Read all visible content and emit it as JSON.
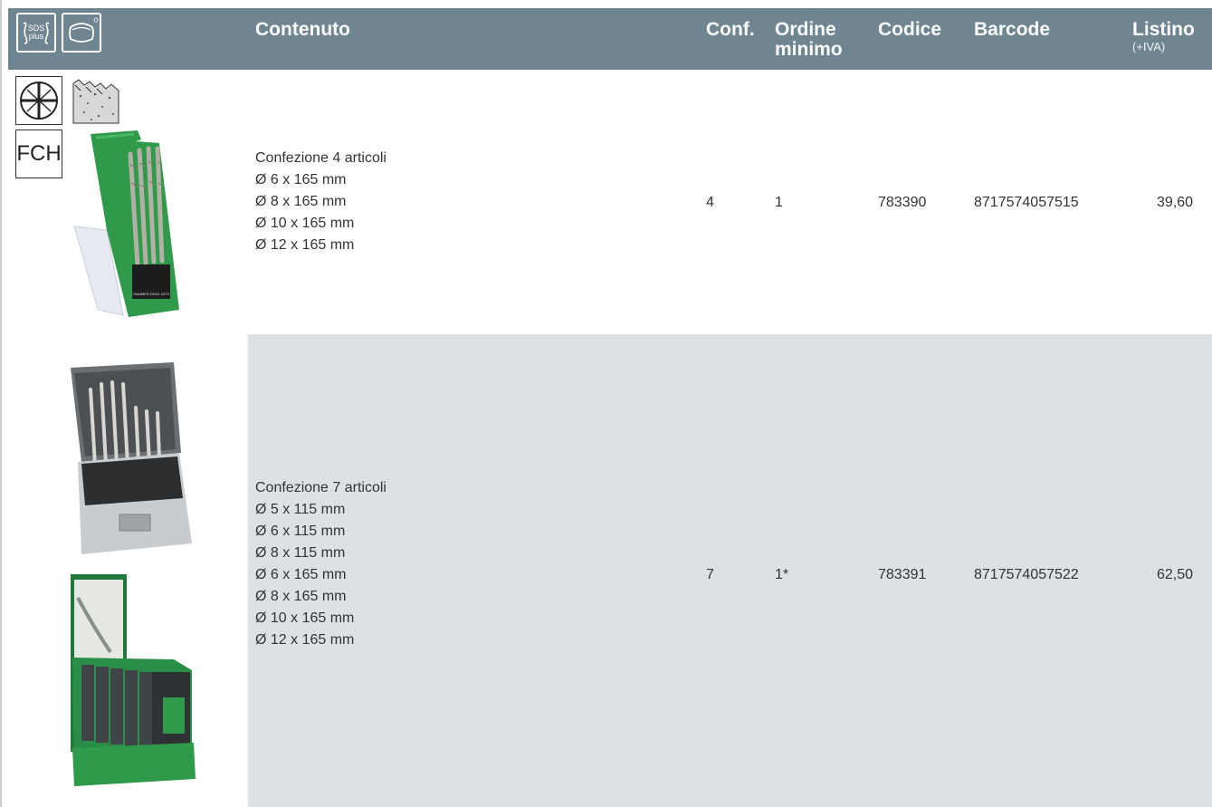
{
  "header": {
    "icons": [
      "sds-plus-icon",
      "shank-icon"
    ],
    "sds_line1": "SDS",
    "sds_line2": "plus",
    "col_contenuto": "Contenuto",
    "col_conf": "Conf.",
    "col_ordine_1": "Ordine",
    "col_ordine_2": "minimo",
    "col_codice": "Codice",
    "col_barcode": "Barcode",
    "col_listino": "Listino",
    "col_listino_sub": "(+IVA)"
  },
  "badges": {
    "fch": "FCH"
  },
  "rows": [
    {
      "lines": [
        "Confezione 4 articoli",
        "Ø 6 x 165 mm",
        "Ø 8 x 165 mm",
        "Ø 10 x 165 mm",
        "Ø 12 x 165 mm"
      ],
      "conf": "4",
      "ordine": "1",
      "codice": "783390",
      "barcode": "8717574057515",
      "listino": "39,60"
    },
    {
      "lines": [
        "Confezione 7 articoli",
        "Ø 5 x 115 mm",
        "Ø 6 x 115 mm",
        "Ø 8 x 115 mm",
        "Ø 6 x 165 mm",
        "Ø 8 x 165 mm",
        "Ø 10 x 165 mm",
        "Ø 12 x 165 mm"
      ],
      "conf": "7",
      "ordine": "1*",
      "codice": "783391",
      "barcode": "8717574057522",
      "listino": "62,50"
    }
  ],
  "colors": {
    "header_bg": "#6f8591",
    "row_alt_bg": "#dde1e4",
    "case_green": "#2e9a4a"
  }
}
